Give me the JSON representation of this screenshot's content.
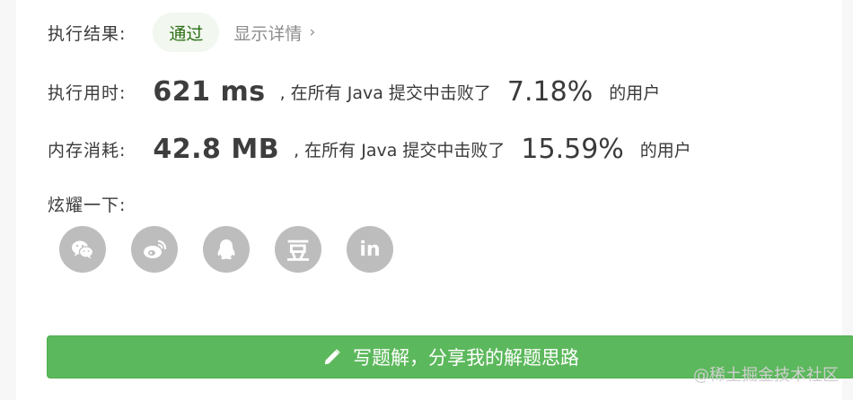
{
  "result": {
    "label": "执行结果:",
    "status": "通过",
    "details": "显示详情",
    "details_chevron": "›"
  },
  "runtime": {
    "label": "执行用时:",
    "value": "621 ms",
    "text": ", 在所有 Java 提交中击败了",
    "percent": "7.18%",
    "suffix": "的用户"
  },
  "memory": {
    "label": "内存消耗:",
    "value": "42.8 MB",
    "text": ", 在所有 Java 提交中击败了",
    "percent": "15.59%",
    "suffix": "的用户"
  },
  "share": {
    "label": "炫耀一下:",
    "icons": [
      "wechat-icon",
      "weibo-icon",
      "qq-icon",
      "douban-icon",
      "linkedin-icon"
    ],
    "douban_glyph": "豆",
    "linkedin_glyph": "in"
  },
  "write_button": {
    "label": "写题解，分享我的解题思路",
    "icon": "pencil-icon"
  },
  "watermark": "@稀土掘金技术社区",
  "colors": {
    "button_green": "#5cb85c",
    "badge_bg": "#f2f7ef",
    "badge_text": "#2b6e14",
    "share_icon_bg": "#bdbdbd"
  }
}
